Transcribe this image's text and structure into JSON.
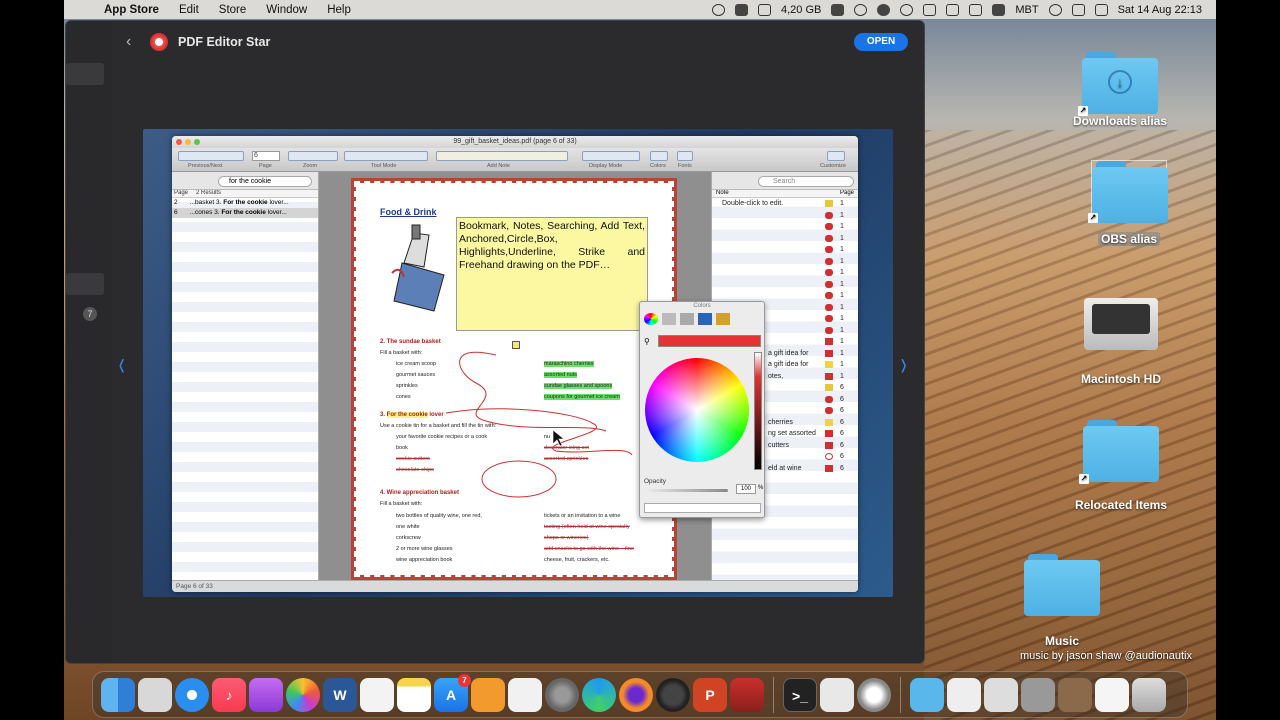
{
  "menubar": {
    "app_name": "App Store",
    "menus": [
      "Edit",
      "Store",
      "Window",
      "Help"
    ],
    "storage": "4,20 GB",
    "input_source": "MBT",
    "datetime": "Sat 14 Aug  22:13"
  },
  "appstore": {
    "title": "PDF Editor Star",
    "open_label": "OPEN",
    "sidebar_badge": "7"
  },
  "pdf_window": {
    "title": "99_gift_basket_ideas.pdf (page 6 of 33)",
    "page_value": "6",
    "toolbar_labels": {
      "prev_next": "Previous/Next",
      "page": "Page",
      "zoom": "Zoom",
      "tool_mode": "Tool Mode",
      "add_note": "Add Note",
      "display_mode": "Display Mode",
      "colors": "Colors",
      "fonts": "Fonts",
      "customize": "Customize"
    },
    "left_search_value": "for the cookie",
    "results_header": {
      "page": "Page",
      "results": "2 Results"
    },
    "results": [
      {
        "page": "2",
        "pre": "...basket 3. ",
        "bold": "For the cookie",
        "post": " lover..."
      },
      {
        "page": "6",
        "pre": "...cones 3. ",
        "bold": "For the cookie",
        "post": " lover..."
      }
    ],
    "right_search_placeholder": "Search",
    "notes_header": {
      "note": "Note",
      "page": "Page"
    },
    "notes": [
      {
        "text": "Double-click to edit.",
        "page": "1",
        "icon": "pencil"
      },
      {
        "text": "",
        "page": "1",
        "icon": "squiggle"
      },
      {
        "text": "",
        "page": "1",
        "icon": "squiggle"
      },
      {
        "text": "",
        "page": "1",
        "icon": "squiggle"
      },
      {
        "text": "",
        "page": "1",
        "icon": "squiggle"
      },
      {
        "text": "",
        "page": "1",
        "icon": "squiggle"
      },
      {
        "text": "",
        "page": "1",
        "icon": "squiggle"
      },
      {
        "text": "",
        "page": "1",
        "icon": "squiggle"
      },
      {
        "text": "",
        "page": "1",
        "icon": "squiggle"
      },
      {
        "text": "",
        "page": "1",
        "icon": "squiggle"
      },
      {
        "text": "",
        "page": "1",
        "icon": "squiggle"
      },
      {
        "text": "",
        "page": "1",
        "icon": "squiggle"
      },
      {
        "text": "",
        "page": "1",
        "icon": "arrow"
      },
      {
        "text": "a gift idea for",
        "page": "1",
        "icon": "strike"
      },
      {
        "text": "a gift idea for",
        "page": "1",
        "icon": "highlight"
      },
      {
        "text": "otes,",
        "page": "1",
        "icon": "strike"
      },
      {
        "text": "",
        "page": "6",
        "icon": "pencil"
      },
      {
        "text": "",
        "page": "6",
        "icon": "squiggle"
      },
      {
        "text": "",
        "page": "6",
        "icon": "squiggle"
      },
      {
        "text": "cherries",
        "page": "6",
        "icon": "highlight"
      },
      {
        "text": "ng set assorted",
        "page": "6",
        "icon": "strike"
      },
      {
        "text": "cutters",
        "page": "6",
        "icon": "strike"
      },
      {
        "text": "",
        "page": "6",
        "icon": "circle"
      },
      {
        "text": "eld at wine",
        "page": "6",
        "icon": "strike"
      }
    ],
    "status": "Page 6 of 33",
    "doc": {
      "section_title": "Food & Drink",
      "note_text": "Bookmark, Notes, Searching, Add Text, Anchored,Circle,Box, Highlights,Underline, Strike and Freehand drawing on the PDF…",
      "s2_title": "2.  The sundae basket",
      "s2_intro": "Fill a basket with:",
      "s2_left": [
        "ice cream scoop",
        "gourmet sauces",
        "sprinkles",
        "cones"
      ],
      "s2_right": [
        "maraschino cherries",
        "assorted nuts",
        "sundae glasses and spoons",
        "coupons for gourmet ice cream"
      ],
      "s3_num": "3.  ",
      "s3_hl": "For the cookie",
      "s3_rest": " lover",
      "s3_intro": "Use a cookie tin for a basket and fill the tin with:",
      "s3_left": [
        "your favorite cookie recipes or a cook",
        "book",
        "cookie cutters",
        "chocolate chips"
      ],
      "s3_right": [
        "nu",
        "decorator icing set",
        "assorted sprinkles"
      ],
      "s4_title": "4.  Wine appreciation basket",
      "s4_intro": "Fill a basket with:",
      "s4_left": [
        "two bottles of quality wine, one red,",
        "one white",
        "corkscrew",
        "2 or more wine glasses",
        "wine appreciation book"
      ],
      "s4_right": [
        "tickets or an invitation to a wine",
        "tasting (often held at wine specialty",
        "shops or wineries)",
        "add snacks to go with the wine – fine",
        "cheese, fruit, crackers, etc."
      ]
    }
  },
  "colors_panel": {
    "title": "Colors",
    "opacity_label": "Opacity",
    "opacity_value": "100",
    "opacity_unit": "%",
    "selected_color": "#e53232"
  },
  "desktop": {
    "icons": [
      {
        "label": "Downloads alias"
      },
      {
        "label": "OBS alias"
      },
      {
        "label": "Macintosh HD"
      },
      {
        "label": "Relocated Items"
      },
      {
        "label": "Music"
      }
    ],
    "credit": "music by jason shaw @audionautix"
  },
  "dock": {
    "appstore_badge": "7",
    "apps": [
      "Finder",
      "Launchpad",
      "Safari",
      "Music",
      "Podcasts",
      "Photos",
      "Word",
      "TextEdit",
      "Notes",
      "App Store",
      "Books",
      "Kindle",
      "System Preferences",
      "Edge",
      "Firefox",
      "OBS",
      "PowerPoint",
      "Window Capture",
      "Terminal",
      "Tips",
      "Screenshot",
      "Downloads",
      "Stack 1",
      "Stack 2",
      "Stack 3",
      "Stack 4",
      "Stack 5",
      "Trash"
    ]
  }
}
